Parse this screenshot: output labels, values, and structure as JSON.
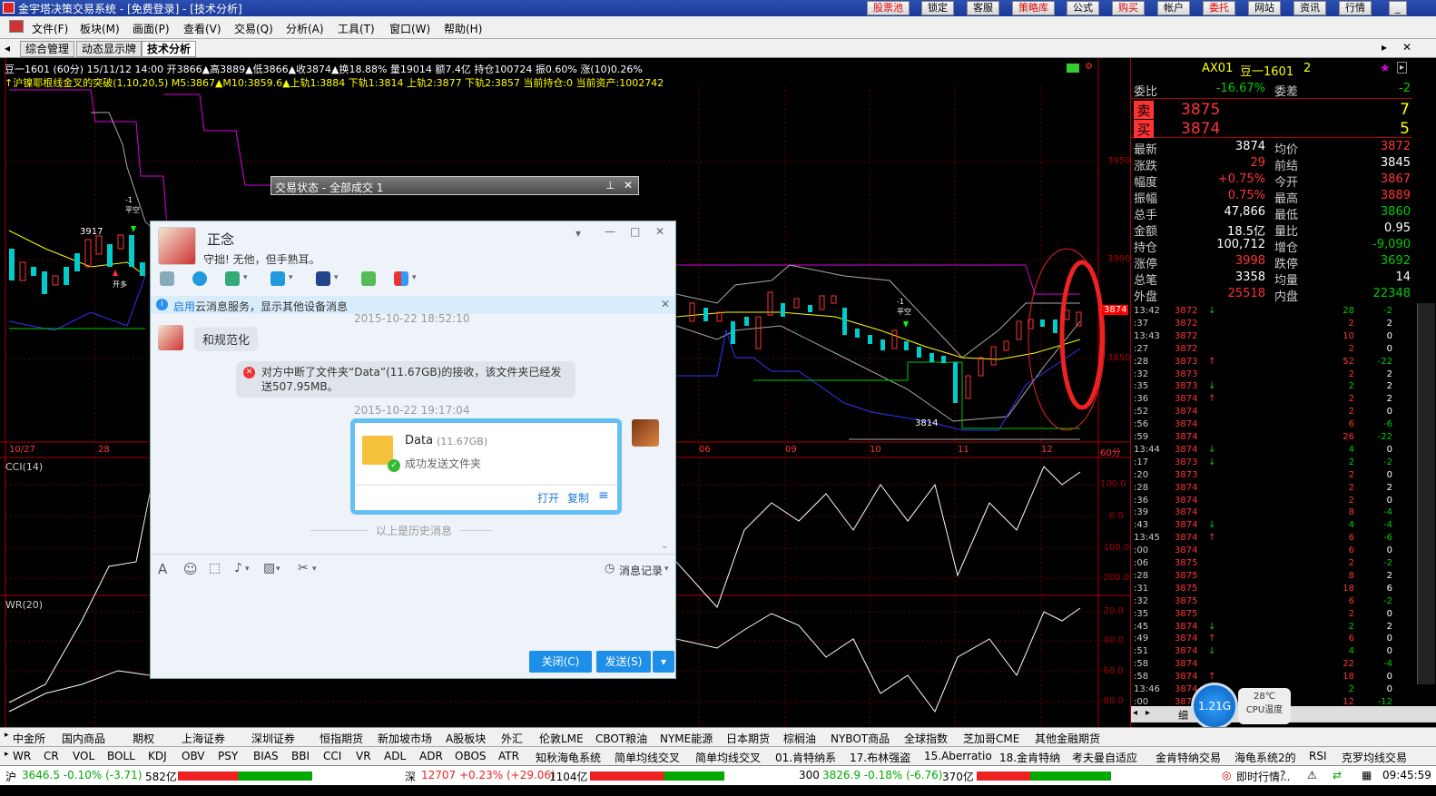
{
  "titlebar": {
    "title": "金宇塔决策交易系统 - [免费登录] - [技术分析]",
    "buttons": [
      "股票池",
      "锁定",
      "客服",
      "策略库",
      "公式",
      "购买",
      "帐户",
      "委托",
      "网站",
      "资讯",
      "行情"
    ]
  },
  "menu": [
    "文件(F)",
    "板块(M)",
    "画面(P)",
    "查看(V)",
    "交易(Q)",
    "分析(A)",
    "工具(T)",
    "窗口(W)",
    "帮助(H)"
  ],
  "tabs": [
    "综合管理",
    "动态显示牌",
    "技术分析"
  ],
  "chart_info": {
    "line1": "豆一1601 (60分) 15/11/12 14:00 开3866▲高3889▲低3866▲收3874▲换18.88% 量19014 额7.4亿 持仓100724 振0.60% 涨(10)0.26%",
    "line2": "↑沪镍耶根线金叉的突破(1,10,20,5) M5:3867▲M10:3859.6▲上轨1:3884 下轨1:3814 上轨2:3877 下轨2:3857 当前持仓:0 当前资产:1002742",
    "price_labels": [
      "3950",
      "3900",
      "3850"
    ],
    "current_price": "3874",
    "date_labels": [
      "10/27",
      "28",
      "06",
      "09",
      "10",
      "11",
      "12",
      "60分"
    ],
    "annotations": {
      "high_point": "3917",
      "low_point": "3814",
      "open_long": "开多",
      "flat_short": "平空",
      "minus1": "-1"
    },
    "cci_title": "CCI(14)",
    "cci_ticks": [
      "100.0",
      "0.0",
      "-100.0",
      "-200.0"
    ],
    "wr_title": "WR(20)",
    "wr_ticks": [
      "-20.0",
      "-40.0",
      "-60.0",
      "-80.0"
    ]
  },
  "quote": {
    "code": "AX01",
    "name": "豆一1601",
    "num": "2",
    "weibi_label": "委比",
    "weibi": "-16.67%",
    "weicha_label": "委差",
    "weicha": "-2",
    "sell_label": "卖",
    "sell_price": "3875",
    "sell_vol": "7",
    "buy_label": "买",
    "buy_price": "3874",
    "buy_vol": "5",
    "rows": [
      {
        "l": "最新",
        "v": "3874",
        "l2": "均价",
        "v2": "3872"
      },
      {
        "l": "涨跌",
        "v": "29",
        "l2": "前结",
        "v2": "3845"
      },
      {
        "l": "幅度",
        "v": "+0.75%",
        "l2": "今开",
        "v2": "3867"
      },
      {
        "l": "振幅",
        "v": "0.75%",
        "l2": "最高",
        "v2": "3889"
      },
      {
        "l": "总手",
        "v": "47,866",
        "l2": "最低",
        "v2": "3860"
      },
      {
        "l": "金额",
        "v": "18.5亿",
        "l2": "量比",
        "v2": "0.95"
      },
      {
        "l": "持仓",
        "v": "100,712",
        "l2": "增仓",
        "v2": "-9,090"
      },
      {
        "l": "涨停",
        "v": "3998",
        "l2": "跌停",
        "v2": "3692"
      },
      {
        "l": "总笔",
        "v": "3358",
        "l2": "均量",
        "v2": "14"
      },
      {
        "l": "外盘",
        "v": "25518",
        "l2": "内盘",
        "v2": "22348"
      }
    ],
    "ticks": [
      {
        "t": "13:42",
        "p": "3872",
        "a": "↓",
        "v": "28",
        "c": "-2"
      },
      {
        "t": ":37",
        "p": "3872",
        "a": "",
        "v": "2",
        "c": "2"
      },
      {
        "t": "13:43",
        "p": "3872",
        "a": "",
        "v": "10",
        "c": "0"
      },
      {
        "t": ":27",
        "p": "3872",
        "a": "",
        "v": "2",
        "c": "0"
      },
      {
        "t": ":28",
        "p": "3873",
        "a": "↑",
        "v": "52",
        "c": "-22"
      },
      {
        "t": ":32",
        "p": "3873",
        "a": "",
        "v": "2",
        "c": "2"
      },
      {
        "t": ":35",
        "p": "3873",
        "a": "↓",
        "v": "2",
        "c": "2"
      },
      {
        "t": ":36",
        "p": "3874",
        "a": "↑",
        "v": "2",
        "c": "2"
      },
      {
        "t": ":52",
        "p": "3874",
        "a": "",
        "v": "2",
        "c": "0"
      },
      {
        "t": ":56",
        "p": "3874",
        "a": "",
        "v": "6",
        "c": "-6"
      },
      {
        "t": ":59",
        "p": "3874",
        "a": "",
        "v": "26",
        "c": "-22"
      },
      {
        "t": "13:44",
        "p": "3874",
        "a": "↓",
        "v": "4",
        "c": "0"
      },
      {
        "t": ":17",
        "p": "3873",
        "a": "↓",
        "v": "2",
        "c": "-2"
      },
      {
        "t": ":20",
        "p": "3873",
        "a": "",
        "v": "2",
        "c": "0"
      },
      {
        "t": ":28",
        "p": "3874",
        "a": "",
        "v": "2",
        "c": "2"
      },
      {
        "t": ":36",
        "p": "3874",
        "a": "",
        "v": "2",
        "c": "0"
      },
      {
        "t": ":39",
        "p": "3874",
        "a": "",
        "v": "8",
        "c": "-4"
      },
      {
        "t": ":43",
        "p": "3874",
        "a": "↓",
        "v": "4",
        "c": "-4"
      },
      {
        "t": "13:45",
        "p": "3874",
        "a": "↑",
        "v": "6",
        "c": "-6"
      },
      {
        "t": ":00",
        "p": "3874",
        "a": "",
        "v": "6",
        "c": "0"
      },
      {
        "t": ":06",
        "p": "3875",
        "a": "",
        "v": "2",
        "c": "-2"
      },
      {
        "t": ":28",
        "p": "3875",
        "a": "",
        "v": "8",
        "c": "2"
      },
      {
        "t": ":31",
        "p": "3875",
        "a": "",
        "v": "18",
        "c": "6"
      },
      {
        "t": ":32",
        "p": "3875",
        "a": "",
        "v": "6",
        "c": "-2"
      },
      {
        "t": ":35",
        "p": "3875",
        "a": "",
        "v": "2",
        "c": "0"
      },
      {
        "t": ":45",
        "p": "3874",
        "a": "↓",
        "v": "2",
        "c": "2"
      },
      {
        "t": ":49",
        "p": "3874",
        "a": "↑",
        "v": "6",
        "c": "0"
      },
      {
        "t": ":51",
        "p": "3874",
        "a": "↓",
        "v": "4",
        "c": "0"
      },
      {
        "t": ":58",
        "p": "3874",
        "a": "",
        "v": "22",
        "c": "-4"
      },
      {
        "t": ":58",
        "p": "3874",
        "a": "↑",
        "v": "18",
        "c": "0"
      },
      {
        "t": "13:46",
        "p": "3874",
        "a": "↓",
        "v": "2",
        "c": "0"
      },
      {
        "t": ":00",
        "p": "3874",
        "a": "↑",
        "v": "12",
        "c": "-12"
      }
    ],
    "bottom_tab": "细",
    "cpu_value": "1.21G",
    "temp": "28℃",
    "temp_label": "CPU温度"
  },
  "trade_window": {
    "title": "交易状态 - 全部成交 1"
  },
  "chat": {
    "name": "正念",
    "signature": "守拙! 无他，但手熟耳。",
    "notice_link": "启用",
    "notice_text": "云消息服务，显示其他设备消息",
    "time1": "2015-10-22 18:52:10",
    "msg1": "和规范化",
    "system_msg": "对方中断了文件夹“Data”(11.67GB)的接收，该文件夹已经发送507.95MB。",
    "time2": "2015-10-22 19:17:04",
    "file_name": "Data",
    "file_size": "(11.67GB)",
    "file_status": "成功发送文件夹",
    "open": "打开",
    "copy": "复制",
    "history": "以上是历史消息",
    "msg_record": "消息记录",
    "close_btn": "关闭(C)",
    "send_btn": "发送(S)"
  },
  "toolbar1": [
    "中金所",
    "国内商品",
    "期权",
    "上海证券",
    "深圳证券",
    "恒指期货",
    "新加坡市场",
    "A股板块",
    "外汇",
    "伦敦LME",
    "CBOT粮油",
    "NYME能源",
    "日本期货",
    "棕榈油",
    "NYBOT商品",
    "全球指数",
    "芝加哥CME",
    "其他金融期货"
  ],
  "toolbar2": [
    "WR",
    "CR",
    "VOL",
    "BOLL",
    "KDJ",
    "OBV",
    "PSY",
    "BIAS",
    "BBI",
    "CCI",
    "VR",
    "ADL",
    "ADR",
    "OBOS",
    "ATR",
    "知秋海龟系统",
    "简单均线交叉",
    "简单均线交叉",
    "01.肯特纳系",
    "17.布林强盗",
    "15.Aberratio",
    "18.金肯特纳",
    "考夫曼自适应",
    "金肯特纳交易",
    "海龟系统2的",
    "RSI",
    "克罗均线交易"
  ],
  "status": {
    "sh_label": "沪",
    "sh": "3646.5 -0.10% (-3.71)",
    "sh_amt": "582亿",
    "sz_label": "深",
    "sz": "12707 +0.23% (+29.06)",
    "sz_amt": "1104亿",
    "c300_label": "300",
    "c300": "3826.9 -0.18% (-6.76)",
    "c300_amt": "370亿",
    "realtime": "即时行情...",
    "clock": "09:45:59"
  },
  "colors": {
    "up": "#ff3030",
    "down": "#00e0e0",
    "yellow": "#ffff00",
    "green_arrow": "#00ff00",
    "accent_blue": "#1e8fe8"
  }
}
